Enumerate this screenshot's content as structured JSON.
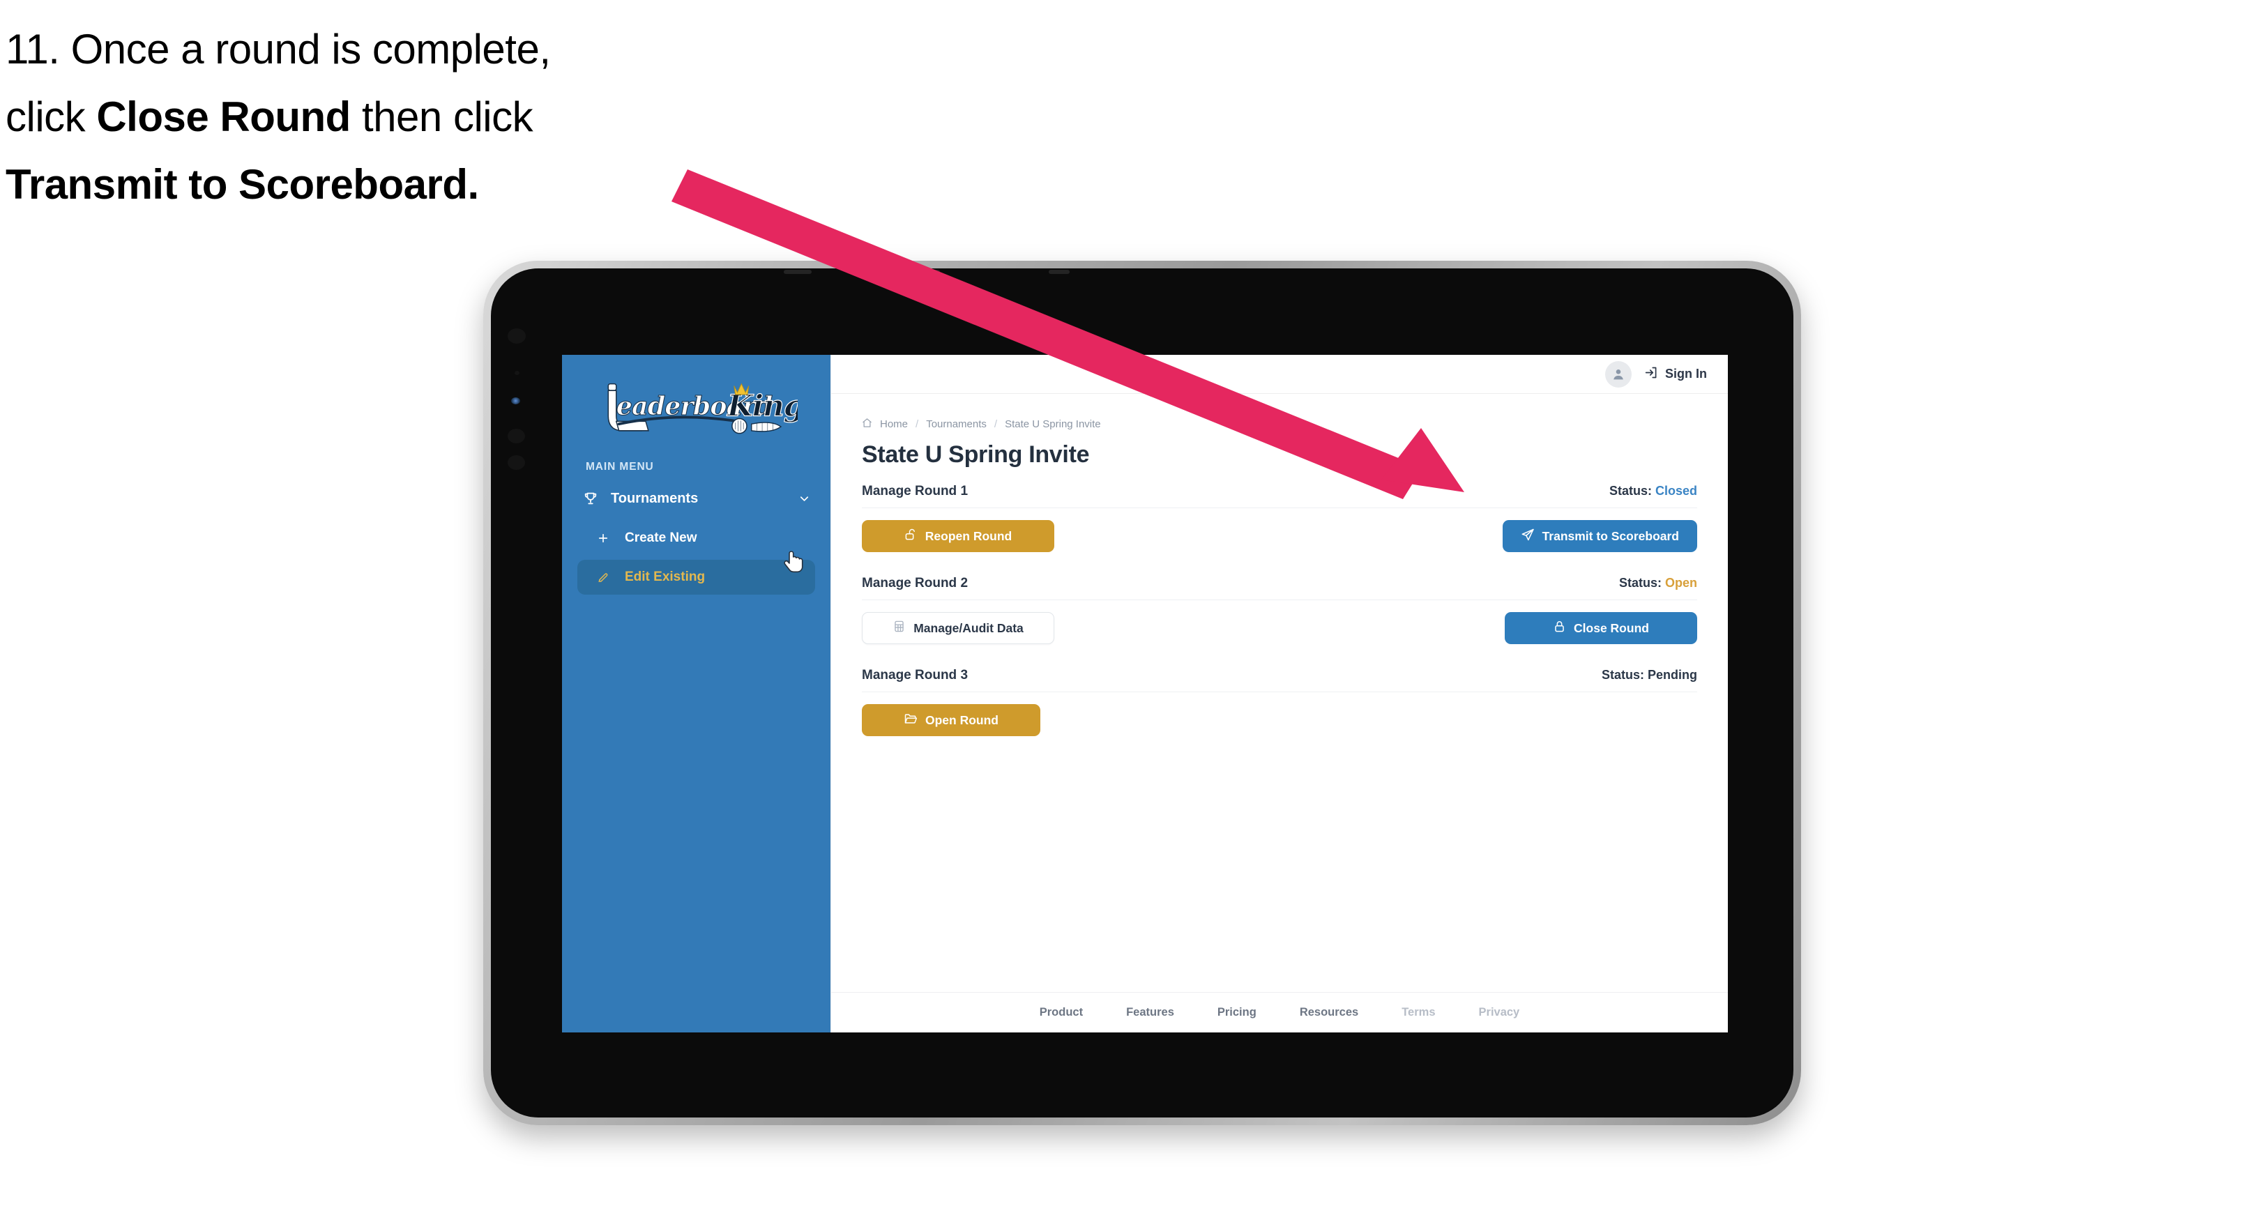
{
  "caption": {
    "line1": "11. Once a round is complete,",
    "line2_pre": "click ",
    "line2_bold": "Close Round",
    "line2_post": " then click",
    "line3_bold": "Transmit to Scoreboard."
  },
  "colors": {
    "brand_blue": "#337ab7",
    "button_blue": "#2e7dbc",
    "gold": "#cf9b2c",
    "status_closed": "#3a84c4",
    "status_open": "#d8a03a",
    "status_pending": "#2b3748",
    "annotation_pink": "#e5275f",
    "sidebar_active_bg": "#2a6d9f",
    "sidebar_active_text": "#e3b84f"
  },
  "sidebar": {
    "logo_text_primary": "Leaderboard",
    "logo_text_secondary": "King",
    "menu_label": "MAIN MENU",
    "items": [
      {
        "label": "Tournaments",
        "icon": "trophy-icon",
        "chevron": "chevron-down-icon",
        "type": "group"
      },
      {
        "label": "Create New",
        "icon": "plus-icon",
        "type": "sub",
        "active": false
      },
      {
        "label": "Edit Existing",
        "icon": "edit-icon",
        "type": "sub",
        "active": true
      }
    ]
  },
  "topbar": {
    "avatar_icon": "user-avatar-icon",
    "signin_icon": "login-arrow-icon",
    "signin_label": "Sign In"
  },
  "breadcrumb": {
    "home_icon": "home-icon",
    "items": [
      "Home",
      "Tournaments",
      "State U Spring Invite"
    ],
    "separator": "/"
  },
  "page": {
    "title": "State U Spring Invite"
  },
  "rounds": [
    {
      "title": "Manage Round 1",
      "status_label": "Status:",
      "status_value": "Closed",
      "status_color": "#3a84c4",
      "left_button": {
        "label": "Reopen Round",
        "icon": "unlock-icon",
        "style": "gold"
      },
      "right_button": {
        "label": "Transmit to Scoreboard",
        "icon": "paper-plane-icon",
        "style": "blue"
      }
    },
    {
      "title": "Manage Round 2",
      "status_label": "Status:",
      "status_value": "Open",
      "status_color": "#d8a03a",
      "left_button": {
        "label": "Manage/Audit Data",
        "icon": "table-grid-icon",
        "style": "ghost"
      },
      "right_button": {
        "label": "Close Round",
        "icon": "lock-icon",
        "style": "blue"
      }
    },
    {
      "title": "Manage Round 3",
      "status_label": "Status:",
      "status_value": "Pending",
      "status_color": "#2b3748",
      "left_button": {
        "label": "Open Round",
        "icon": "folder-open-icon",
        "style": "gold"
      },
      "right_button": null
    }
  ],
  "footer": {
    "links": [
      {
        "label": "Product",
        "dim": false
      },
      {
        "label": "Features",
        "dim": false
      },
      {
        "label": "Pricing",
        "dim": false
      },
      {
        "label": "Resources",
        "dim": false
      },
      {
        "label": "Terms",
        "dim": true
      },
      {
        "label": "Privacy",
        "dim": true
      }
    ]
  },
  "annotation": {
    "type": "arrow",
    "color": "#e5275f",
    "points_to": "Transmit to Scoreboard"
  },
  "cursor": {
    "type": "pointing-hand",
    "over": "Edit Existing"
  }
}
